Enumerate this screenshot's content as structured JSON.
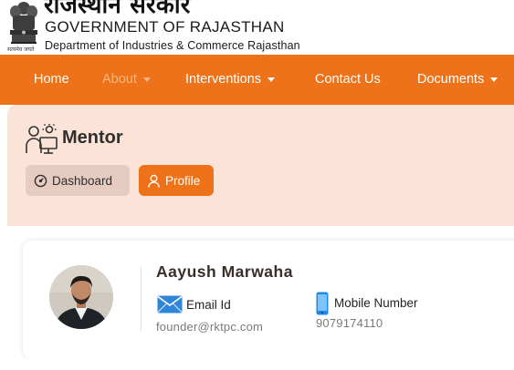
{
  "header": {
    "hindi_title": "राजस्थान सरकार",
    "gov_name": "GOVERNMENT OF RAJASTHAN",
    "department": "Department of Industries & Commerce Rajasthan",
    "emblem_caption": "सत्यमेव जयते"
  },
  "nav": {
    "home": "Home",
    "about": "About",
    "interventions": "Interventions",
    "contact": "Contact Us",
    "documents": "Documents"
  },
  "page": {
    "title": "Mentor",
    "dashboard_button": "Dashboard",
    "profile_button": "Profile"
  },
  "profile": {
    "name": "Aayush Marwaha",
    "email_label": "Email Id",
    "email_value": "founder@rktpc.com",
    "mobile_label": "Mobile Number",
    "mobile_value": "9079174110"
  },
  "colors": {
    "brand_orange": "#ee7219",
    "peach_background": "#fbe3d8",
    "dashboard_button_bg": "#e6cbc0"
  },
  "icons": {
    "emblem": "ashoka-emblem-icon",
    "mentor": "mentor-icon",
    "dashboard": "speedometer-icon",
    "profile": "user-icon",
    "email": "envelope-icon",
    "mobile": "mobile-phone-icon"
  }
}
